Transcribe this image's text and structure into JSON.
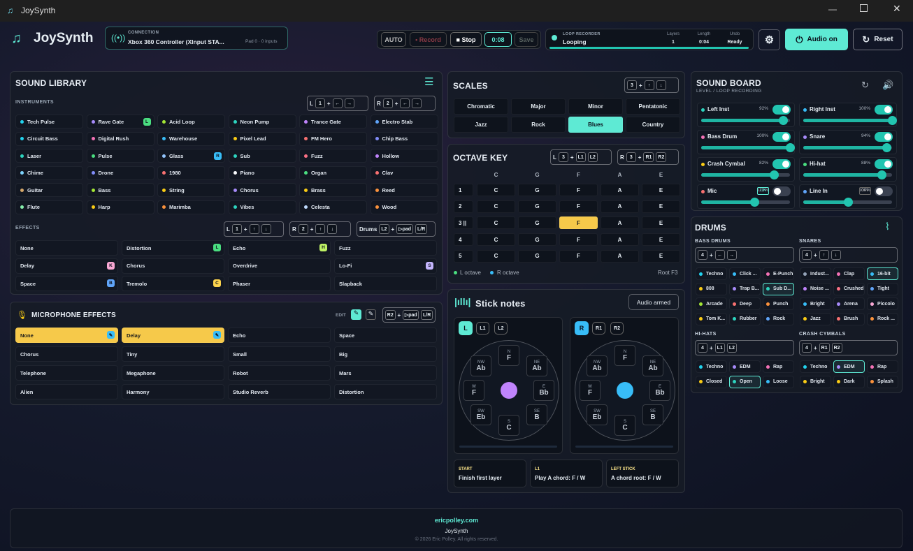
{
  "window": {
    "title": "JoySynth"
  },
  "header": {
    "app_name": "JoySynth",
    "connection_label": "CONNECTION",
    "connection_value": "Xbox 360 Controller (XInput STA...",
    "connection_meta": "Pad 0 · 0 inputs",
    "auto": "AUTO",
    "record": "• Record",
    "stop": "■ Stop",
    "time": "0:08",
    "save": "Save",
    "loop_label": "LOOP RECORDER",
    "loop_value": "Looping",
    "layers_label": "Layers",
    "layers_value": "1",
    "length_label": "Length",
    "length_value": "0:04",
    "undo_label": "Undo",
    "undo_value": "Ready",
    "audio_on": "Audio on",
    "reset": "Reset"
  },
  "library": {
    "title": "SOUND LIBRARY",
    "instruments_label": "INSTRUMENTS",
    "effects_label": "EFFECTS",
    "drums_combo": "Drums",
    "instruments": [
      {
        "l": "Tech Pulse",
        "c": "#22d3ee"
      },
      {
        "l": "Rave Gate",
        "c": "#a78bfa",
        "b": "L",
        "bc": "#4ade80"
      },
      {
        "l": "Acid Loop",
        "c": "#a3e635"
      },
      {
        "l": "Neon Pump",
        "c": "#2dd4bf"
      },
      {
        "l": "Trance Gate",
        "c": "#c084fc"
      },
      {
        "l": "Electro Stab",
        "c": "#60a5fa"
      },
      {
        "l": "Circuit Bass",
        "c": "#22d3ee"
      },
      {
        "l": "Digital Rush",
        "c": "#f472b6"
      },
      {
        "l": "Warehouse",
        "c": "#38bdf8"
      },
      {
        "l": "Pixel Lead",
        "c": "#facc15"
      },
      {
        "l": "FM Hero",
        "c": "#f87171"
      },
      {
        "l": "Chip Bass",
        "c": "#818cf8"
      },
      {
        "l": "Laser",
        "c": "#2dd4bf"
      },
      {
        "l": "Pulse",
        "c": "#4ade80"
      },
      {
        "l": "Glass",
        "c": "#93c5fd",
        "b": "R",
        "bc": "#38bdf8"
      },
      {
        "l": "Sub",
        "c": "#2dd4bf"
      },
      {
        "l": "Fuzz",
        "c": "#fb7185"
      },
      {
        "l": "Hollow",
        "c": "#c084fc"
      },
      {
        "l": "Chime",
        "c": "#7dd3fc"
      },
      {
        "l": "Drone",
        "c": "#818cf8"
      },
      {
        "l": "1980",
        "c": "#f87171"
      },
      {
        "l": "Piano",
        "c": "#f8fafc"
      },
      {
        "l": "Organ",
        "c": "#4ade80"
      },
      {
        "l": "Clav",
        "c": "#f87171"
      },
      {
        "l": "Guitar",
        "c": "#d6a86a"
      },
      {
        "l": "Bass",
        "c": "#a3e635"
      },
      {
        "l": "String",
        "c": "#facc15"
      },
      {
        "l": "Chorus",
        "c": "#a78bfa"
      },
      {
        "l": "Brass",
        "c": "#facc15"
      },
      {
        "l": "Reed",
        "c": "#fb923c"
      },
      {
        "l": "Flute",
        "c": "#86efac"
      },
      {
        "l": "Harp",
        "c": "#facc15"
      },
      {
        "l": "Marimba",
        "c": "#fb923c"
      },
      {
        "l": "Vibes",
        "c": "#2dd4bf"
      },
      {
        "l": "Celesta",
        "c": "#bfdbfe"
      },
      {
        "l": "Wood",
        "c": "#fb923c"
      }
    ],
    "effects": [
      {
        "l": "None"
      },
      {
        "l": "Distortion",
        "b": "L",
        "bc": "#4ade80"
      },
      {
        "l": "Echo",
        "b": "H",
        "bc": "#bef264"
      },
      {
        "l": "Fuzz"
      },
      {
        "l": "Delay",
        "b": "K",
        "bc": "#f9a8d4"
      },
      {
        "l": "Chorus"
      },
      {
        "l": "Overdrive"
      },
      {
        "l": "Lo-Fi",
        "b": "S",
        "bc": "#c4b5fd"
      },
      {
        "l": "Space",
        "b": "B",
        "bc": "#60a5fa"
      },
      {
        "l": "Tremolo",
        "b": "C",
        "bc": "#fcd34d"
      },
      {
        "l": "Phaser"
      },
      {
        "l": "Slapback"
      }
    ]
  },
  "mic": {
    "title": "MICROPHONE EFFECTS",
    "edit": "EDIT",
    "items": [
      "None",
      "Delay",
      "Echo",
      "Space",
      "Chorus",
      "Tiny",
      "Small",
      "Big",
      "Telephone",
      "Megaphone",
      "Robot",
      "Mars",
      "Alien",
      "Harmony",
      "Studio Reverb",
      "Distortion"
    ]
  },
  "scales": {
    "title": "SCALES",
    "items": [
      "Chromatic",
      "Major",
      "Minor",
      "Pentatonic",
      "Jazz",
      "Rock",
      "Blues",
      "Country"
    ],
    "selected": "Blues"
  },
  "octave": {
    "title": "OCTAVE KEY",
    "cols": [
      "C",
      "G",
      "F",
      "A",
      "E"
    ],
    "rows": [
      "1",
      "2",
      "3",
      "4",
      "5"
    ],
    "legend_l": "L octave",
    "legend_r": "R octave",
    "root": "Root F3"
  },
  "stick": {
    "title": "Stick notes",
    "audio_armed": "Audio armed",
    "left": {
      "tag": "L",
      "b1": "L1",
      "b2": "L2",
      "n": "F",
      "ne": "Ab",
      "e": "Bb",
      "se": "B",
      "s": "C",
      "sw": "Eb",
      "w": "F",
      "nw": "Ab"
    },
    "right": {
      "tag": "R",
      "b1": "R1",
      "b2": "R2",
      "n": "F",
      "ne": "Ab",
      "e": "Bb",
      "se": "B",
      "s": "C",
      "sw": "Eb",
      "w": "F",
      "nw": "Ab"
    },
    "dirs": {
      "n": "N",
      "ne": "NE",
      "e": "E",
      "se": "SE",
      "s": "S",
      "sw": "SW",
      "w": "W",
      "nw": "NW"
    },
    "hints": [
      {
        "k": "START",
        "v": "Finish first layer"
      },
      {
        "k": "L1",
        "v": "Play A chord: F / W"
      },
      {
        "k": "LEFT STICK",
        "v": "A chord root: F / W"
      }
    ]
  },
  "board": {
    "title": "SOUND BOARD",
    "subtitle": "LEVEL / LOOP RECORDING",
    "channels": [
      {
        "l": "Left Inst",
        "v": "92%",
        "c": "#2dd4bf",
        "lvl": 0.92,
        "on": true
      },
      {
        "l": "Right Inst",
        "v": "100%",
        "c": "#38bdf8",
        "lvl": 1.0,
        "on": true
      },
      {
        "l": "Bass Drum",
        "v": "100%",
        "c": "#f472b6",
        "lvl": 1.0,
        "on": true
      },
      {
        "l": "Snare",
        "v": "94%",
        "c": "#a78bfa",
        "lvl": 0.94,
        "on": true
      },
      {
        "l": "Crash Cymbal",
        "v": "82%",
        "c": "#facc15",
        "lvl": 0.82,
        "on": true
      },
      {
        "l": "Hi-hat",
        "v": "88%",
        "c": "#4ade80",
        "lvl": 0.88,
        "on": true
      },
      {
        "l": "Mic",
        "v": "121%",
        "c": "#f87171",
        "lvl": 0.6,
        "on": false,
        "tag": "ON"
      },
      {
        "l": "Line In",
        "v": "100%",
        "c": "#60a5fa",
        "lvl": 0.5,
        "on": false,
        "tag": "OFF"
      }
    ]
  },
  "drums": {
    "title": "DRUMS",
    "bass_label": "BASS DRUMS",
    "snares_label": "SNARES",
    "hihats_label": "HI-HATS",
    "crash_label": "CRASH CYMBALS",
    "bass": [
      {
        "l": "Techno",
        "c": "#22d3ee"
      },
      {
        "l": "Click ...",
        "c": "#38bdf8"
      },
      {
        "l": "E-Punch",
        "c": "#f472b6"
      },
      {
        "l": "808",
        "c": "#facc15"
      },
      {
        "l": "Trap B...",
        "c": "#a78bfa"
      },
      {
        "l": "Sub D...",
        "c": "#2dd4bf",
        "sel": true
      },
      {
        "l": "Arcade",
        "c": "#a3e635"
      },
      {
        "l": "Deep",
        "c": "#f87171"
      },
      {
        "l": "Punch",
        "c": "#fb923c"
      },
      {
        "l": "Tom K...",
        "c": "#facc15"
      },
      {
        "l": "Rubber",
        "c": "#2dd4bf"
      },
      {
        "l": "Rock",
        "c": "#60a5fa"
      }
    ],
    "snares": [
      {
        "l": "Indust...",
        "c": "#94a3b8"
      },
      {
        "l": "Clap",
        "c": "#f472b6"
      },
      {
        "l": "16-bit",
        "c": "#38bdf8",
        "sel": true
      },
      {
        "l": "Noise ...",
        "c": "#c084fc"
      },
      {
        "l": "Crushed",
        "c": "#fb7185"
      },
      {
        "l": "Tight",
        "c": "#60a5fa"
      },
      {
        "l": "Bright",
        "c": "#38bdf8"
      },
      {
        "l": "Arena",
        "c": "#a78bfa"
      },
      {
        "l": "Piccolo",
        "c": "#f9a8d4"
      },
      {
        "l": "Jazz",
        "c": "#facc15"
      },
      {
        "l": "Brush",
        "c": "#f87171"
      },
      {
        "l": "Rock ...",
        "c": "#fb923c"
      }
    ],
    "hihats": [
      {
        "l": "Techno",
        "c": "#22d3ee"
      },
      {
        "l": "EDM",
        "c": "#a78bfa"
      },
      {
        "l": "Rap",
        "c": "#f472b6"
      },
      {
        "l": "Closed",
        "c": "#facc15"
      },
      {
        "l": "Open",
        "c": "#2dd4bf",
        "sel": true
      },
      {
        "l": "Loose",
        "c": "#38bdf8"
      }
    ],
    "crash": [
      {
        "l": "Techno",
        "c": "#22d3ee"
      },
      {
        "l": "EDM",
        "c": "#a78bfa",
        "sel": true
      },
      {
        "l": "Rap",
        "c": "#f472b6"
      },
      {
        "l": "Bright",
        "c": "#facc15"
      },
      {
        "l": "Dark",
        "c": "#facc15"
      },
      {
        "l": "Splash",
        "c": "#fb923c"
      }
    ]
  },
  "footer": {
    "link": "ericpolley.com",
    "name": "JoySynth",
    "copy": "© 2026 Eric Polley. All rights reserved."
  },
  "combos": {
    "arrows_l": [
      "L",
      "1",
      "+",
      "←",
      "→"
    ],
    "arrows_r": [
      "R",
      "2",
      "+",
      "←",
      "→"
    ]
  }
}
